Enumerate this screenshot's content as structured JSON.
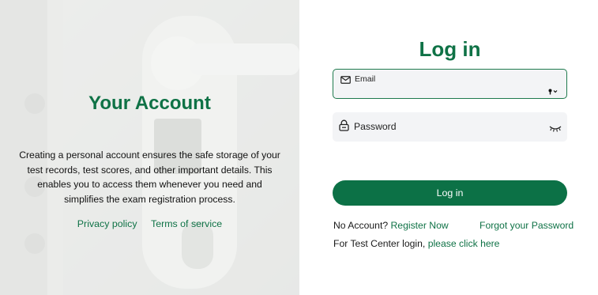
{
  "left": {
    "title": "Your Account",
    "description": "Creating a personal account ensures the safe storage of your test records, test scores, and other important details. This enables you to access them whenever you need and simplifies the exam registration process.",
    "links": {
      "privacy": "Privacy policy",
      "terms": "Terms of service"
    }
  },
  "login": {
    "title": "Log in",
    "email_label": "Email",
    "password_label": "Password",
    "button_label": "Log in",
    "no_account_text": "No Account?",
    "register_link": "Register Now",
    "forgot_link": "Forgot your Password",
    "test_center_text": "For Test Center login,",
    "test_center_link": "please click here"
  },
  "colors": {
    "brand_green": "#0f7246",
    "button_green": "#0c7146",
    "field_bg": "#f3f4f6"
  },
  "icons": {
    "email": "mail-icon",
    "password": "lock-icon",
    "autofill": "key-icon",
    "visibility": "eye-closed-icon"
  }
}
